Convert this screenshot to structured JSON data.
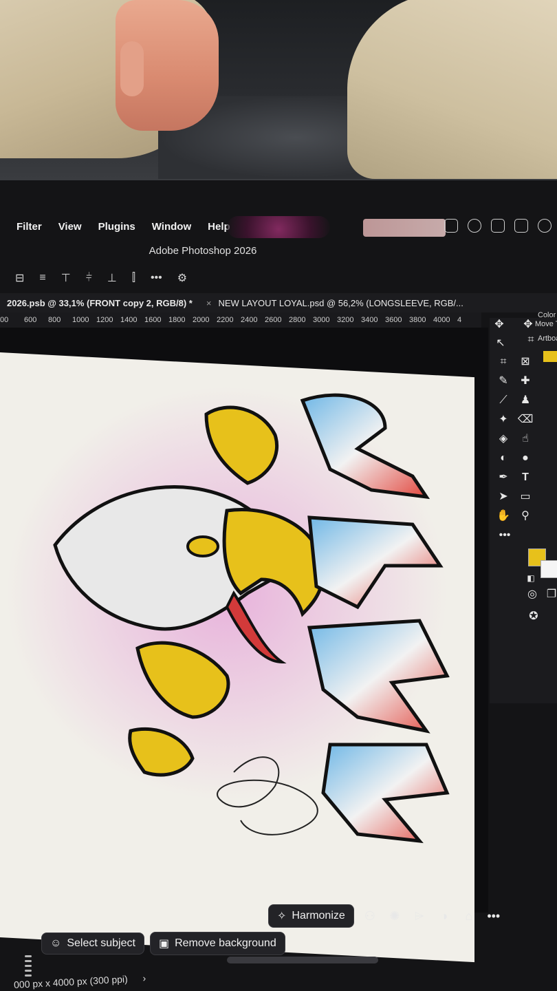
{
  "menu": {
    "items": [
      "Filter",
      "View",
      "Plugins",
      "Window",
      "Help"
    ]
  },
  "app": {
    "title": "Adobe Photoshop 2026"
  },
  "optionsbar": {
    "more_label": "•••"
  },
  "tabs": [
    {
      "label": "2026.psb @ 33,1% (FRONT copy 2, RGB/8) *",
      "active": true
    },
    {
      "label": "NEW LAYOUT LOYAL.psd @ 56,2% (LONGSLEEVE, RGB/...",
      "active": false
    }
  ],
  "ruler": {
    "ticks": [
      "00",
      "600",
      "800",
      "1000",
      "1200",
      "1400",
      "1600",
      "1800",
      "2000",
      "2200",
      "2400",
      "2600",
      "2800",
      "3000",
      "3200",
      "3400",
      "3600",
      "3800",
      "4000",
      "4"
    ]
  },
  "panel": {
    "color_label": "Color",
    "move_tool_label": "Move T",
    "artboard_label": "Artboa"
  },
  "toolbar": {
    "more_label": "•••",
    "type_tool_glyph": "T"
  },
  "contextbar": {
    "select_subject": "Select subject",
    "remove_background": "Remove background",
    "harmonize": "Harmonize",
    "more_label": "•••"
  },
  "docinfo": {
    "text": "000 px x 4000 px (300 ppi)",
    "chevron": "›"
  },
  "colors": {
    "foreground": "#e7c11b",
    "background": "#f5f5f5",
    "artboard": "#f1efe9"
  }
}
